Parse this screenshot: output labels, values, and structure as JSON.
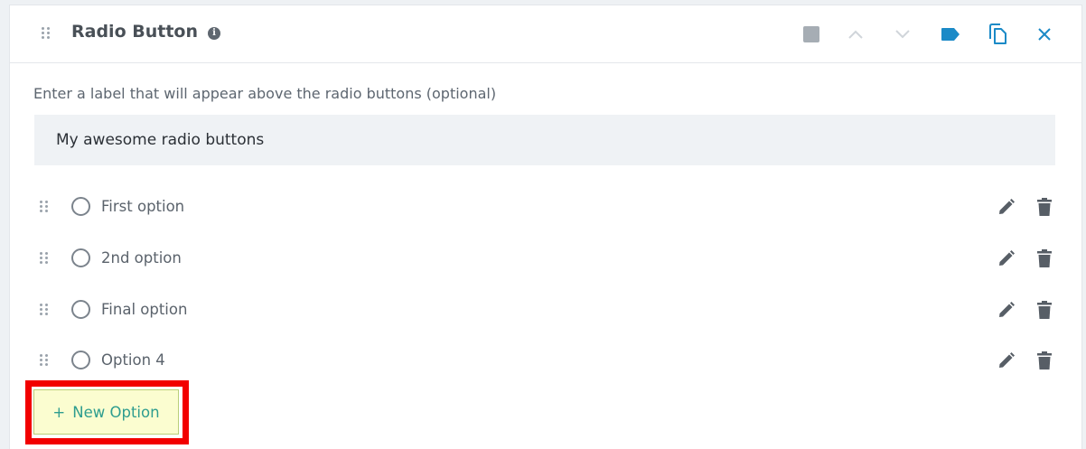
{
  "header": {
    "title": "Radio Button",
    "icons": [
      "info-icon",
      "square-icon",
      "chevron-up-icon",
      "chevron-down-icon",
      "tag-icon",
      "copy-icon",
      "close-icon"
    ]
  },
  "label_field": {
    "prompt": "Enter a label that will appear above the radio buttons (optional)",
    "value": "My awesome radio buttons"
  },
  "options": [
    {
      "label": "First option"
    },
    {
      "label": "2nd option"
    },
    {
      "label": "Final option"
    },
    {
      "label": "Option 4"
    }
  ],
  "new_option_button": {
    "icon": "+",
    "label": "New Option"
  },
  "colors": {
    "accent_blue": "#1b8ac7",
    "highlight_red": "#f20000",
    "button_bg": "#fbfdd0",
    "button_text": "#2e9d8f"
  }
}
